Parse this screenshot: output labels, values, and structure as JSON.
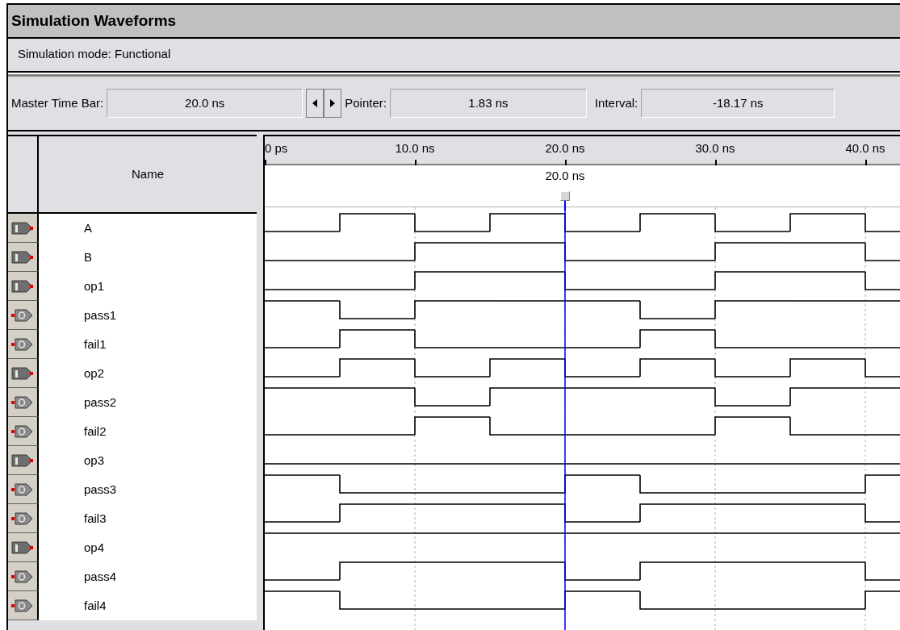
{
  "window": {
    "title": "Simulation Waveforms"
  },
  "mode": "Simulation mode: Functional",
  "toolbar": {
    "master_label": "Master Time Bar:",
    "master_value": "20.0 ns",
    "pointer_label": "Pointer:",
    "pointer_value": "1.83 ns",
    "interval_label": "Interval:",
    "interval_value": "-18.17 ns"
  },
  "name_header": "Name",
  "ruler": {
    "ticks": [
      "0 ps",
      "10.0 ns",
      "20.0 ns",
      "30.0 ns",
      "40.0 ns"
    ]
  },
  "cursor": {
    "label": "20.0 ns"
  },
  "signals": [
    {
      "name": "A",
      "kind": "input",
      "high": [
        false,
        true,
        false,
        true,
        false,
        true,
        false,
        true,
        false
      ]
    },
    {
      "name": "B",
      "kind": "input",
      "high": [
        false,
        false,
        true,
        true,
        false,
        false,
        true,
        true,
        false
      ]
    },
    {
      "name": "op1",
      "kind": "input",
      "high": [
        false,
        false,
        true,
        true,
        false,
        false,
        true,
        true,
        false
      ]
    },
    {
      "name": "pass1",
      "kind": "output",
      "high": [
        true,
        false,
        true,
        true,
        true,
        false,
        true,
        true,
        true
      ]
    },
    {
      "name": "fail1",
      "kind": "output",
      "high": [
        false,
        true,
        false,
        false,
        false,
        true,
        false,
        false,
        false
      ]
    },
    {
      "name": "op2",
      "kind": "input",
      "high": [
        false,
        true,
        false,
        true,
        false,
        true,
        false,
        true,
        false
      ]
    },
    {
      "name": "pass2",
      "kind": "output",
      "high": [
        true,
        true,
        false,
        true,
        true,
        true,
        false,
        true,
        true
      ]
    },
    {
      "name": "fail2",
      "kind": "output",
      "high": [
        false,
        false,
        true,
        false,
        false,
        false,
        true,
        false,
        false
      ]
    },
    {
      "name": "op3",
      "kind": "input",
      "high": [
        false,
        false,
        false,
        false,
        false,
        false,
        false,
        false,
        false
      ]
    },
    {
      "name": "pass3",
      "kind": "output",
      "high": [
        true,
        false,
        false,
        false,
        true,
        false,
        false,
        false,
        true
      ]
    },
    {
      "name": "fail3",
      "kind": "output",
      "high": [
        false,
        true,
        true,
        true,
        false,
        true,
        true,
        true,
        false
      ]
    },
    {
      "name": "op4",
      "kind": "input",
      "high": [
        true,
        true,
        true,
        true,
        true,
        true,
        true,
        true,
        true
      ]
    },
    {
      "name": "pass4",
      "kind": "output",
      "high": [
        false,
        true,
        true,
        true,
        false,
        true,
        true,
        true,
        false
      ]
    },
    {
      "name": "fail4",
      "kind": "output",
      "high": [
        true,
        false,
        false,
        false,
        true,
        false,
        false,
        false,
        true
      ]
    }
  ]
}
